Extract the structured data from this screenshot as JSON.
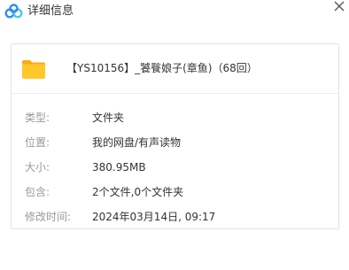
{
  "window": {
    "title": "详细信息"
  },
  "file": {
    "name": "【YS10156】_饕餮娘子(章鱼)（68回）",
    "type_icon": "folder-icon"
  },
  "details": [
    {
      "label": "类型:",
      "value": "文件夹"
    },
    {
      "label": "位置:",
      "value": "我的网盘/有声读物"
    },
    {
      "label": "大小:",
      "value": "380.95MB"
    },
    {
      "label": "包含:",
      "value": "2个文件,0个文件夹"
    },
    {
      "label": "修改时间:",
      "value": "2024年03月14日, 09:17"
    }
  ],
  "colors": {
    "folder_yellow": "#FFC72C",
    "folder_yellow_dark": "#F5AE14",
    "logo_blue": "#2F8BF5",
    "logo_cyan": "#48C9F0",
    "label_gray": "#999999",
    "text_dark": "#333333"
  }
}
